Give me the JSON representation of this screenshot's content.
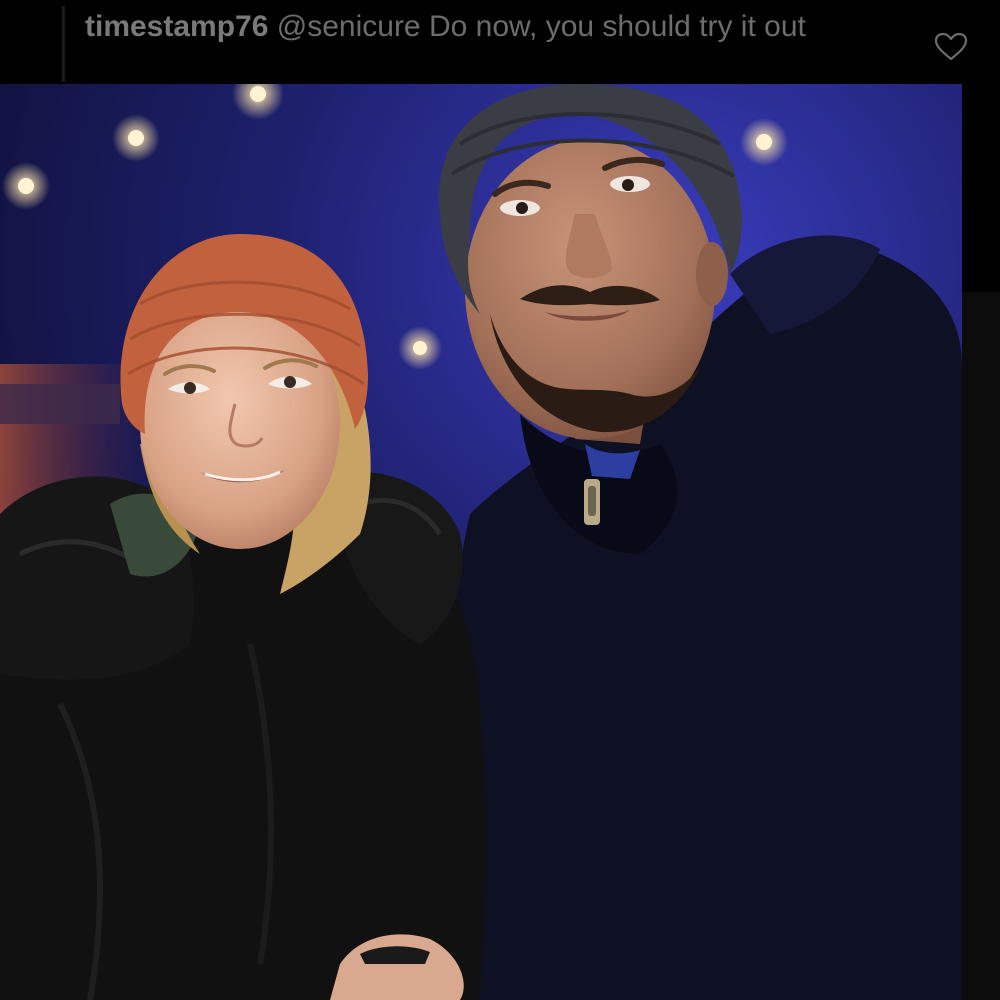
{
  "comment": {
    "username": "timestamp76",
    "mention": "@senicure",
    "text": "Do now, you should try it out"
  },
  "icons": {
    "like": "heart-outline-icon"
  },
  "colors": {
    "background": "#000000",
    "comment_text": "#6d6d6d",
    "username_text": "#7a7a7a"
  }
}
